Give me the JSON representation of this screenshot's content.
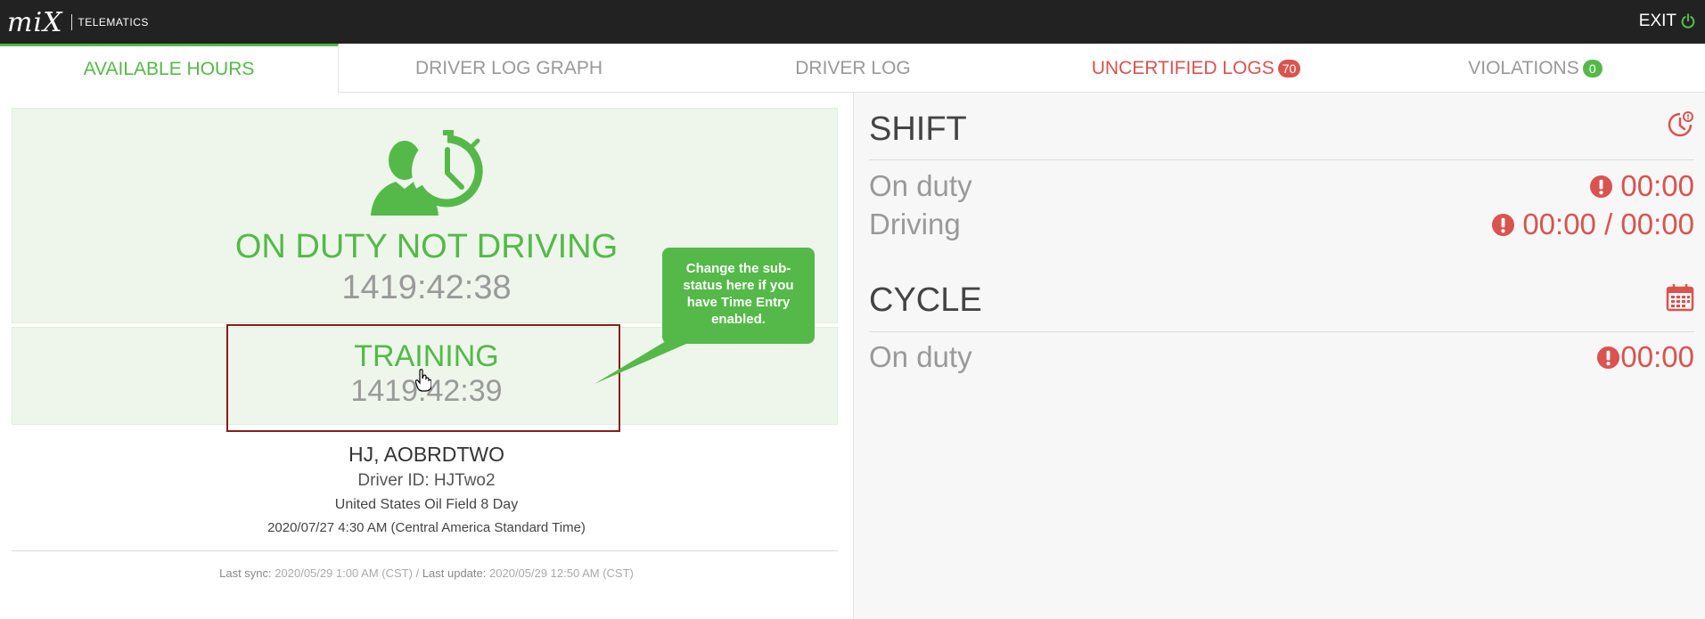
{
  "header": {
    "logo_text": "TELEMATICS",
    "exit_label": "EXIT"
  },
  "tabs": [
    {
      "label": "AVAILABLE HOURS",
      "active": true
    },
    {
      "label": "DRIVER LOG GRAPH"
    },
    {
      "label": "DRIVER LOG"
    },
    {
      "label": "UNCERTIFIED LOGS",
      "badge": "70"
    },
    {
      "label": "VIOLATIONS",
      "badge": "0"
    }
  ],
  "status": {
    "title": "ON DUTY NOT DRIVING",
    "time": "1419:42:38",
    "sub_title": "TRAINING",
    "sub_time": "1419:42:39"
  },
  "callout": {
    "text": "Change the sub-status here if you have Time Entry enabled."
  },
  "driver": {
    "name": "HJ, AOBRDTWO",
    "id_line": "Driver ID: HJTwo2",
    "ruleset": "United States Oil Field 8 Day",
    "datetime": "2020/07/27 4:30 AM (Central America Standard Time)"
  },
  "sync": {
    "last_sync_label": "Last sync:",
    "last_sync_value": "2020/05/29 1:00 AM (CST)",
    "separator": "/",
    "last_update_label": "Last update:",
    "last_update_value": "2020/05/29 12:50 AM (CST)"
  },
  "shift": {
    "title": "SHIFT",
    "rows": [
      {
        "label": "On duty",
        "value": "00:00"
      },
      {
        "label": "Driving",
        "value": "00:00 / 00:00"
      }
    ]
  },
  "cycle": {
    "title": "CYCLE",
    "rows": [
      {
        "label": "On duty",
        "value": "00:00"
      }
    ]
  },
  "colors": {
    "brand_green": "#54b948",
    "alert_red": "#d9534f",
    "topbar": "#222222",
    "highlight_border": "#8b1a1a"
  },
  "icons": {
    "status": "person-clock-icon",
    "shift": "clock-alert-icon",
    "cycle": "calendar-icon",
    "alert": "exclamation-circle-icon",
    "exit": "power-icon"
  }
}
